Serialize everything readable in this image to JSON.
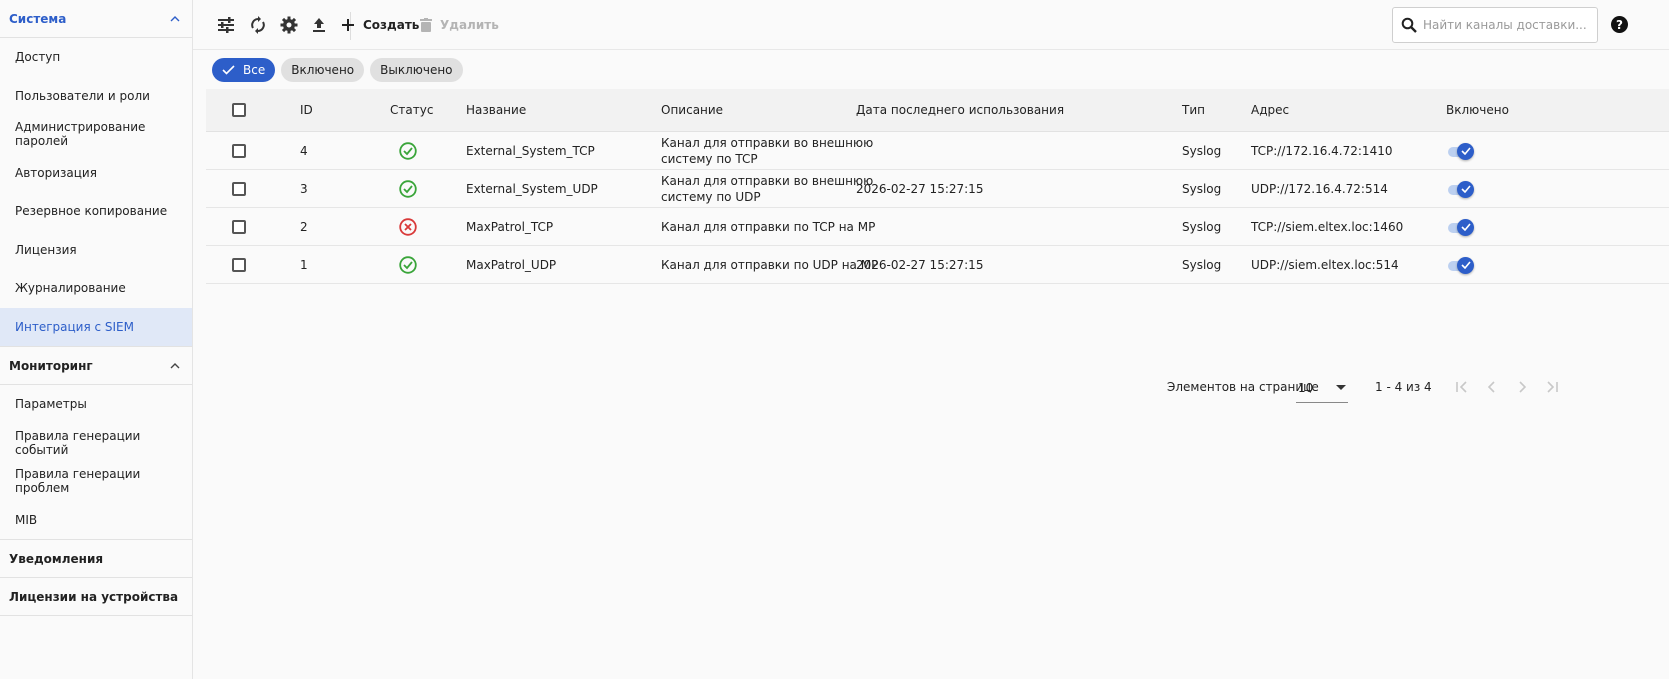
{
  "sidebar": {
    "sections": [
      {
        "label": "Система",
        "expanded": true,
        "active": true,
        "items": [
          {
            "label": "Доступ"
          },
          {
            "label": "Пользователи и роли"
          },
          {
            "label": "Администрирование паролей"
          },
          {
            "label": "Авторизация"
          },
          {
            "label": "Резервное копирование"
          },
          {
            "label": "Лицензия"
          },
          {
            "label": "Журналирование"
          },
          {
            "label": "Интеграция с SIEM",
            "selected": true
          }
        ]
      },
      {
        "label": "Мониторинг",
        "expanded": true,
        "items": [
          {
            "label": "Параметры"
          },
          {
            "label": "Правила генерации событий"
          },
          {
            "label": "Правила генерации проблем"
          },
          {
            "label": "MIB"
          }
        ]
      },
      {
        "label": "Уведомления",
        "expanded": false
      },
      {
        "label": "Лицензии на устройства",
        "expanded": false
      }
    ]
  },
  "toolbar": {
    "icons": [
      "tune-icon",
      "refresh-icon",
      "settings-icon",
      "upload-icon"
    ],
    "create_label": "Создать",
    "delete_label": "Удалить",
    "search_placeholder": "Найти каналы доставки...",
    "help_label": "?"
  },
  "filters": {
    "all": "Все",
    "enabled": "Включено",
    "disabled": "Выключено",
    "active": "all"
  },
  "table": {
    "headers": {
      "id": "ID",
      "status": "Статус",
      "name": "Название",
      "description": "Описание",
      "last_used": "Дата последнего использования",
      "type": "Тип",
      "address": "Адрес",
      "enabled": "Включено"
    },
    "rows": [
      {
        "id": "4",
        "status": "ok",
        "name": "External_System_TCP",
        "description_1": "Канал для отправки во внешнюю",
        "description_2": "систему по TCP",
        "last_used": "",
        "type": "Syslog",
        "address": "TCP://172.16.4.72:1410",
        "enabled": true
      },
      {
        "id": "3",
        "status": "ok",
        "name": "External_System_UDP",
        "description_1": "Канал для отправки во внешнюю",
        "description_2": "систему по UDP",
        "last_used": "2026-02-27 15:27:15",
        "type": "Syslog",
        "address": "UDP://172.16.4.72:514",
        "enabled": true
      },
      {
        "id": "2",
        "status": "error",
        "name": "MaxPatrol_TCP",
        "description_1": "Канал для отправки по TCP на MP",
        "description_2": "",
        "last_used": "",
        "type": "Syslog",
        "address": "TCP://siem.eltex.loc:1460",
        "enabled": true
      },
      {
        "id": "1",
        "status": "ok",
        "name": "MaxPatrol_UDP",
        "description_1": "Канал для отправки по UDP на MP",
        "description_2": "",
        "last_used": "2026-02-27 15:27:15",
        "type": "Syslog",
        "address": "UDP://siem.eltex.loc:514",
        "enabled": true
      }
    ]
  },
  "pagination": {
    "per_page_label": "Элементов на странице",
    "per_page": "10",
    "range": "1 - 4 из 4"
  },
  "colors": {
    "accent": "#2d5ec9",
    "ok": "#3aa53a",
    "error": "#d93a3a"
  }
}
